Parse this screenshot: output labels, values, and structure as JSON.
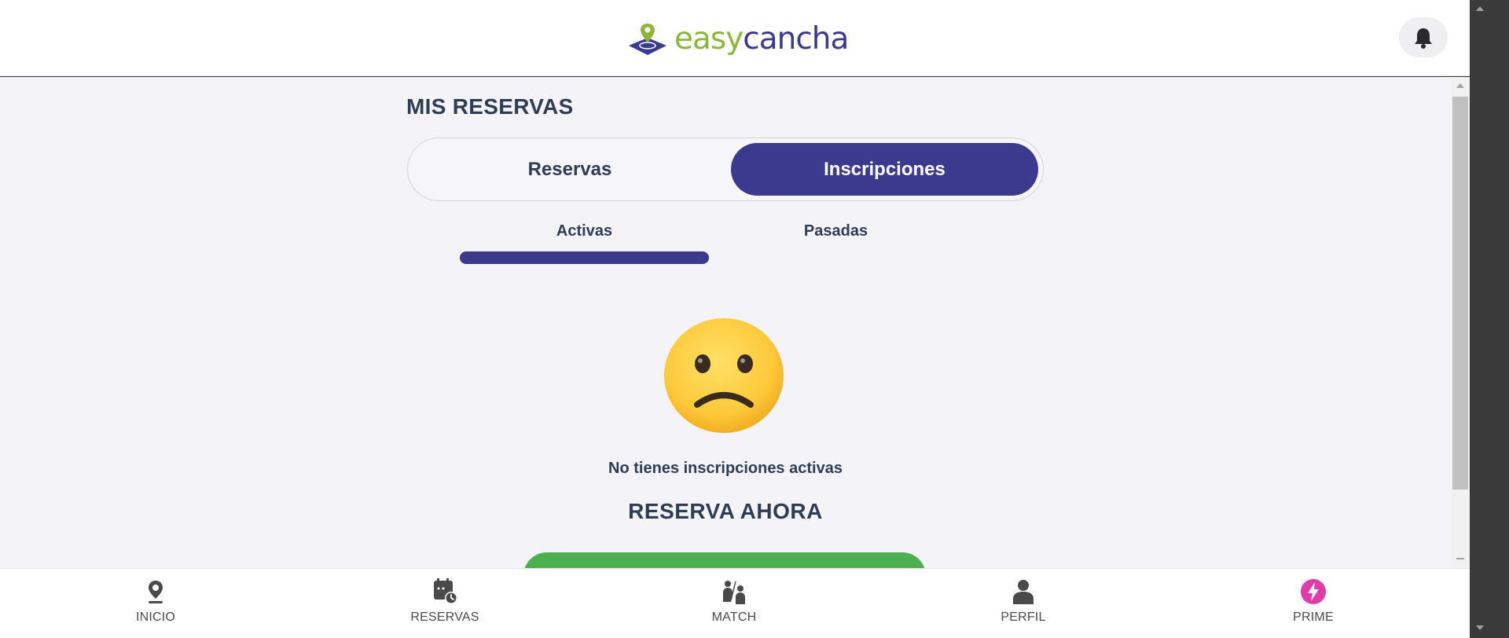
{
  "header": {
    "logo": {
      "part1": "easy",
      "part2": "cancha",
      "icon": "location-pin-on-field-icon"
    },
    "notifications_icon": "bell-icon"
  },
  "main": {
    "title": "MIS RESERVAS",
    "segments": [
      {
        "label": "Reservas",
        "selected": false
      },
      {
        "label": "Inscripciones",
        "selected": true
      }
    ],
    "subtabs": [
      {
        "label": "Activas",
        "selected": true
      },
      {
        "label": "Pasadas",
        "selected": false
      }
    ],
    "empty_state": {
      "emoji": "slightly-frowning-face-icon",
      "message": "No tienes inscripciones activas"
    },
    "cta_title": "RESERVA AHORA"
  },
  "bottom_nav": [
    {
      "label": "INICIO",
      "icon": "location-pin-icon"
    },
    {
      "label": "RESERVAS",
      "icon": "calendar-clock-icon"
    },
    {
      "label": "MATCH",
      "icon": "players-icon"
    },
    {
      "label": "PERFIL",
      "icon": "user-icon"
    },
    {
      "label": "PRIME",
      "icon": "lightning-icon"
    }
  ],
  "colors": {
    "brand_primary": "#3b3a8f",
    "brand_green": "#8bb83a",
    "cta_green": "#4caf50",
    "prime_pink": "#e03ca8",
    "text_dark": "#2e3d55",
    "background": "#f3f3f8"
  }
}
